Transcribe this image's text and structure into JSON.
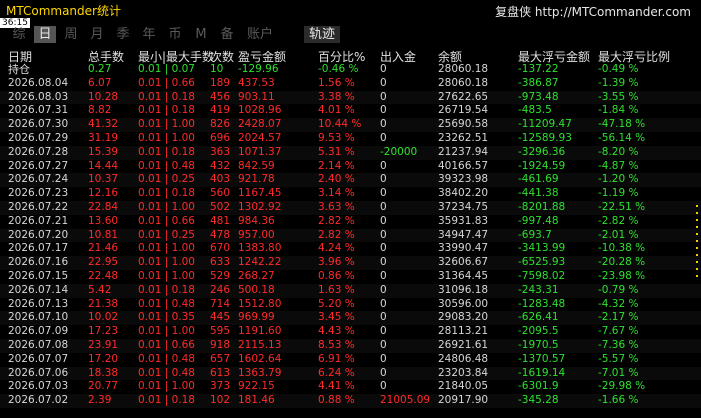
{
  "app": {
    "title": "MTCommander统计",
    "clock": "36:15",
    "site": "复盘侠 http://MTCommander.com"
  },
  "tabs": [
    {
      "label": "综",
      "active": false
    },
    {
      "label": "日",
      "active": true
    },
    {
      "label": "周",
      "active": false
    },
    {
      "label": "月",
      "active": false
    },
    {
      "label": "季",
      "active": false
    },
    {
      "label": "年",
      "active": false
    },
    {
      "label": "币",
      "active": false
    },
    {
      "label": "M",
      "active": false
    },
    {
      "label": "备",
      "active": false
    },
    {
      "label": "账户",
      "active": false
    }
  ],
  "track_button": "轨迹",
  "columns": [
    "日期",
    "总手数",
    "最小|最大手数",
    "次数",
    "盈亏金额",
    "百分比%",
    "出入金",
    "余额",
    "最大浮亏金额",
    "最大浮亏比例"
  ],
  "summary": {
    "label": "持仓",
    "lots": "0.27",
    "minmax": "0.01 | 0.07",
    "count": "10",
    "pnl": "-129.96",
    "pct": "-0.46 %",
    "flow": "0",
    "balance": "28060.18",
    "max_dd_amt": "-137.22",
    "max_dd_pct": "-0.49 %"
  },
  "rows": [
    {
      "date": "2026.08.04",
      "lots": "6.07",
      "minmax": "0.01 | 0.66",
      "count": "189",
      "pnl": "437.53",
      "pct": "1.56 %",
      "flow": "0",
      "balance": "28060.18",
      "dd_amt": "-386.87",
      "dd_pct": "-1.39 %"
    },
    {
      "date": "2026.08.03",
      "lots": "10.28",
      "minmax": "0.01 | 0.18",
      "count": "456",
      "pnl": "903.11",
      "pct": "3.38 %",
      "flow": "0",
      "balance": "27622.65",
      "dd_amt": "-973.48",
      "dd_pct": "-3.55 %"
    },
    {
      "date": "2026.07.31",
      "lots": "8.82",
      "minmax": "0.01 | 0.18",
      "count": "419",
      "pnl": "1028.96",
      "pct": "4.01 %",
      "flow": "0",
      "balance": "26719.54",
      "dd_amt": "-483.5",
      "dd_pct": "-1.84 %"
    },
    {
      "date": "2026.07.30",
      "lots": "41.32",
      "minmax": "0.01 | 1.00",
      "count": "826",
      "pnl": "2428.07",
      "pct": "10.44 %",
      "flow": "0",
      "balance": "25690.58",
      "dd_amt": "-11209.47",
      "dd_pct": "-47.18 %"
    },
    {
      "date": "2026.07.29",
      "lots": "31.19",
      "minmax": "0.01 | 1.00",
      "count": "696",
      "pnl": "2024.57",
      "pct": "9.53 %",
      "flow": "0",
      "balance": "23262.51",
      "dd_amt": "-12589.93",
      "dd_pct": "-56.14 %"
    },
    {
      "date": "2026.07.28",
      "lots": "15.39",
      "minmax": "0.01 | 0.18",
      "count": "363",
      "pnl": "1071.37",
      "pct": "5.31 %",
      "flow": "-20000",
      "balance": "21237.94",
      "dd_amt": "-3296.36",
      "dd_pct": "-8.20 %"
    },
    {
      "date": "2026.07.27",
      "lots": "14.44",
      "minmax": "0.01 | 0.48",
      "count": "432",
      "pnl": "842.59",
      "pct": "2.14 %",
      "flow": "0",
      "balance": "40166.57",
      "dd_amt": "-1924.59",
      "dd_pct": "-4.87 %"
    },
    {
      "date": "2026.07.24",
      "lots": "10.37",
      "minmax": "0.01 | 0.25",
      "count": "403",
      "pnl": "921.78",
      "pct": "2.40 %",
      "flow": "0",
      "balance": "39323.98",
      "dd_amt": "-461.69",
      "dd_pct": "-1.20 %"
    },
    {
      "date": "2026.07.23",
      "lots": "12.16",
      "minmax": "0.01 | 0.18",
      "count": "560",
      "pnl": "1167.45",
      "pct": "3.14 %",
      "flow": "0",
      "balance": "38402.20",
      "dd_amt": "-441.38",
      "dd_pct": "-1.19 %"
    },
    {
      "date": "2026.07.22",
      "lots": "22.84",
      "minmax": "0.01 | 1.00",
      "count": "502",
      "pnl": "1302.92",
      "pct": "3.63 %",
      "flow": "0",
      "balance": "37234.75",
      "dd_amt": "-8201.88",
      "dd_pct": "-22.51 %"
    },
    {
      "date": "2026.07.21",
      "lots": "13.60",
      "minmax": "0.01 | 0.66",
      "count": "481",
      "pnl": "984.36",
      "pct": "2.82 %",
      "flow": "0",
      "balance": "35931.83",
      "dd_amt": "-997.48",
      "dd_pct": "-2.82 %"
    },
    {
      "date": "2026.07.20",
      "lots": "10.81",
      "minmax": "0.01 | 0.25",
      "count": "478",
      "pnl": "957.00",
      "pct": "2.82 %",
      "flow": "0",
      "balance": "34947.47",
      "dd_amt": "-693.7",
      "dd_pct": "-2.01 %"
    },
    {
      "date": "2026.07.17",
      "lots": "21.46",
      "minmax": "0.01 | 1.00",
      "count": "670",
      "pnl": "1383.80",
      "pct": "4.24 %",
      "flow": "0",
      "balance": "33990.47",
      "dd_amt": "-3413.99",
      "dd_pct": "-10.38 %"
    },
    {
      "date": "2026.07.16",
      "lots": "22.95",
      "minmax": "0.01 | 1.00",
      "count": "633",
      "pnl": "1242.22",
      "pct": "3.96 %",
      "flow": "0",
      "balance": "32606.67",
      "dd_amt": "-6525.93",
      "dd_pct": "-20.28 %"
    },
    {
      "date": "2026.07.15",
      "lots": "22.48",
      "minmax": "0.01 | 1.00",
      "count": "529",
      "pnl": "268.27",
      "pct": "0.86 %",
      "flow": "0",
      "balance": "31364.45",
      "dd_amt": "-7598.02",
      "dd_pct": "-23.98 %"
    },
    {
      "date": "2026.07.14",
      "lots": "5.42",
      "minmax": "0.01 | 0.18",
      "count": "246",
      "pnl": "500.18",
      "pct": "1.63 %",
      "flow": "0",
      "balance": "31096.18",
      "dd_amt": "-243.31",
      "dd_pct": "-0.79 %"
    },
    {
      "date": "2026.07.13",
      "lots": "21.38",
      "minmax": "0.01 | 0.48",
      "count": "714",
      "pnl": "1512.80",
      "pct": "5.20 %",
      "flow": "0",
      "balance": "30596.00",
      "dd_amt": "-1283.48",
      "dd_pct": "-4.32 %"
    },
    {
      "date": "2026.07.10",
      "lots": "10.02",
      "minmax": "0.01 | 0.35",
      "count": "445",
      "pnl": "969.99",
      "pct": "3.45 %",
      "flow": "0",
      "balance": "29083.20",
      "dd_amt": "-626.41",
      "dd_pct": "-2.17 %"
    },
    {
      "date": "2026.07.09",
      "lots": "17.23",
      "minmax": "0.01 | 1.00",
      "count": "595",
      "pnl": "1191.60",
      "pct": "4.43 %",
      "flow": "0",
      "balance": "28113.21",
      "dd_amt": "-2095.5",
      "dd_pct": "-7.67 %"
    },
    {
      "date": "2026.07.08",
      "lots": "23.91",
      "minmax": "0.01 | 0.66",
      "count": "918",
      "pnl": "2115.13",
      "pct": "8.53 %",
      "flow": "0",
      "balance": "26921.61",
      "dd_amt": "-1970.5",
      "dd_pct": "-7.36 %"
    },
    {
      "date": "2026.07.07",
      "lots": "17.20",
      "minmax": "0.01 | 0.48",
      "count": "657",
      "pnl": "1602.64",
      "pct": "6.91 %",
      "flow": "0",
      "balance": "24806.48",
      "dd_amt": "-1370.57",
      "dd_pct": "-5.57 %"
    },
    {
      "date": "2026.07.06",
      "lots": "18.38",
      "minmax": "0.01 | 0.48",
      "count": "613",
      "pnl": "1363.79",
      "pct": "6.24 %",
      "flow": "0",
      "balance": "23203.84",
      "dd_amt": "-1619.14",
      "dd_pct": "-7.01 %"
    },
    {
      "date": "2026.07.03",
      "lots": "20.77",
      "minmax": "0.01 | 1.00",
      "count": "373",
      "pnl": "922.15",
      "pct": "4.41 %",
      "flow": "0",
      "balance": "21840.05",
      "dd_amt": "-6301.9",
      "dd_pct": "-29.98 %"
    },
    {
      "date": "2026.07.02",
      "lots": "2.39",
      "minmax": "0.01 | 0.18",
      "count": "102",
      "pnl": "181.46",
      "pct": "0.88 %",
      "flow": "21005.09",
      "balance": "20917.90",
      "dd_amt": "-345.28",
      "dd_pct": "-1.66 %"
    }
  ],
  "colors": {
    "background": "#000000",
    "title": "#ffd700",
    "positive": "#ff2a2a",
    "negative": "#2ee02e",
    "neutral": "#d6d6d6"
  }
}
